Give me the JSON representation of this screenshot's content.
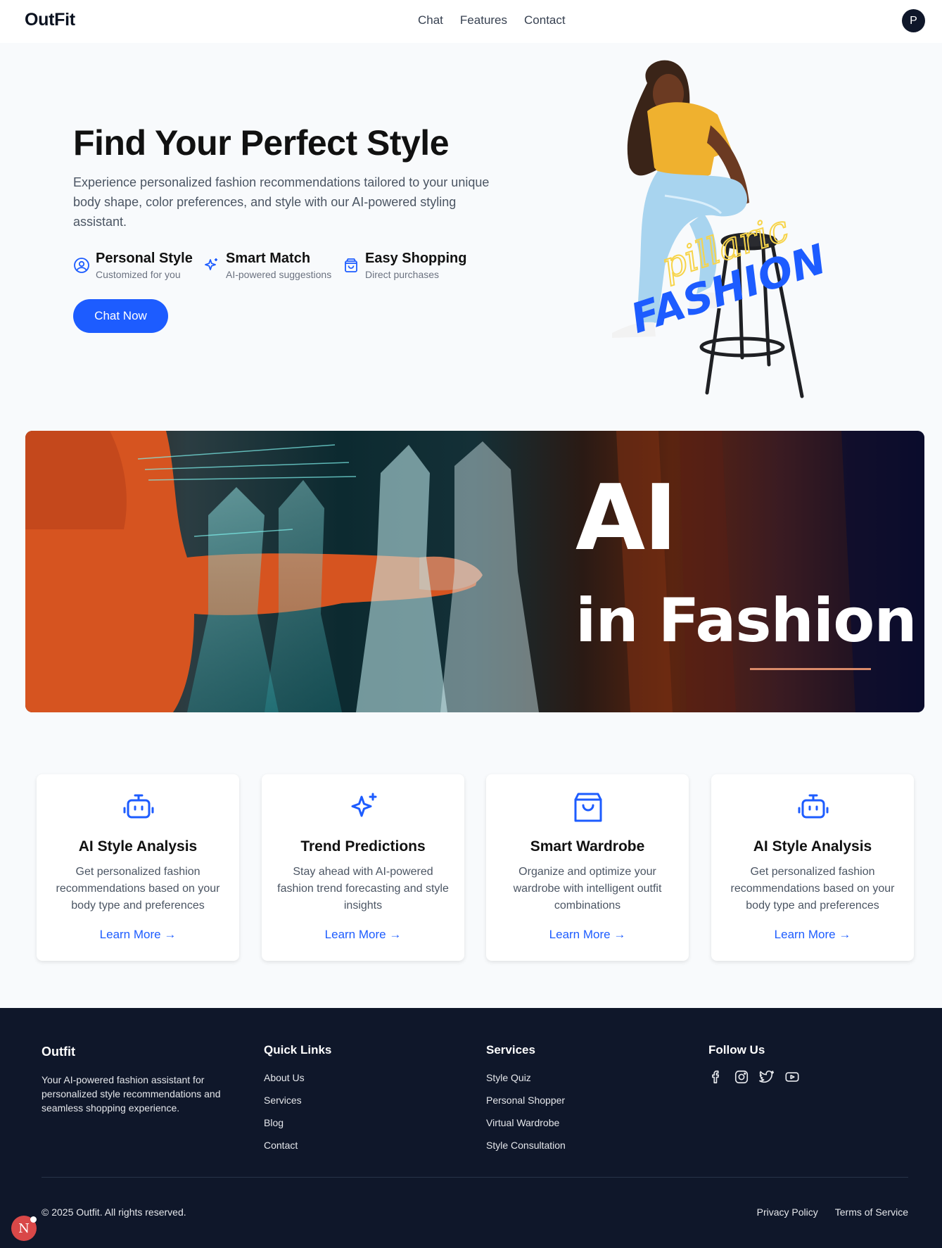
{
  "nav": {
    "logo": "OutFit",
    "links": [
      "Chat",
      "Features",
      "Contact"
    ],
    "avatar_initial": "P"
  },
  "hero": {
    "title": "Find Your Perfect Style",
    "subtitle": "Experience personalized fashion recommendations tailored to your unique body shape, color preferences, and style with our AI-powered styling assistant.",
    "features": [
      {
        "icon": "user-circle-icon",
        "title": "Personal Style",
        "subtitle": "Customized for you"
      },
      {
        "icon": "sparkles-icon",
        "title": "Smart Match",
        "subtitle": "AI-powered suggestions"
      },
      {
        "icon": "shopping-bag-icon",
        "title": "Easy Shopping",
        "subtitle": "Direct purchases"
      }
    ],
    "cta_label": "Chat Now",
    "image_brand_script": "pillaric",
    "image_brand_word": "FASHION"
  },
  "banner": {
    "line1": "AI",
    "line2": "in Fashion"
  },
  "cards": [
    {
      "icon": "robot-icon",
      "title": "AI Style Analysis",
      "description": "Get personalized fashion recommendations based on your body type and preferences",
      "link": "Learn More →"
    },
    {
      "icon": "sparkles-icon",
      "title": "Trend Predictions",
      "description": "Stay ahead with AI-powered fashion trend forecasting and style insights",
      "link": "Learn More →"
    },
    {
      "icon": "shopping-bag-icon",
      "title": "Smart Wardrobe",
      "description": "Organize and optimize your wardrobe with intelligent outfit combinations",
      "link": "Learn More →"
    },
    {
      "icon": "robot-icon",
      "title": "AI Style Analysis",
      "description": "Get personalized fashion recommendations based on your body type and preferences",
      "link": "Learn More →"
    }
  ],
  "footer": {
    "brand": "Outfit",
    "description": "Your AI-powered fashion assistant for personalized style recommendations and seamless shopping experience.",
    "quick_links_title": "Quick Links",
    "quick_links": [
      "About Us",
      "Services",
      "Blog",
      "Contact"
    ],
    "services_title": "Services",
    "services": [
      "Style Quiz",
      "Personal Shopper",
      "Virtual Wardrobe",
      "Style Consultation"
    ],
    "follow_title": "Follow Us",
    "social_icons": [
      "facebook-icon",
      "instagram-icon",
      "twitter-icon",
      "youtube-icon"
    ],
    "copyright": "© 2025 Outfit. All rights reserved.",
    "legal": [
      "Privacy Policy",
      "Terms of Service"
    ]
  },
  "dev_badge": "N",
  "colors": {
    "accent": "#1d5cff",
    "footer_bg": "#0f172a",
    "page_bg": "#f8fafc"
  }
}
